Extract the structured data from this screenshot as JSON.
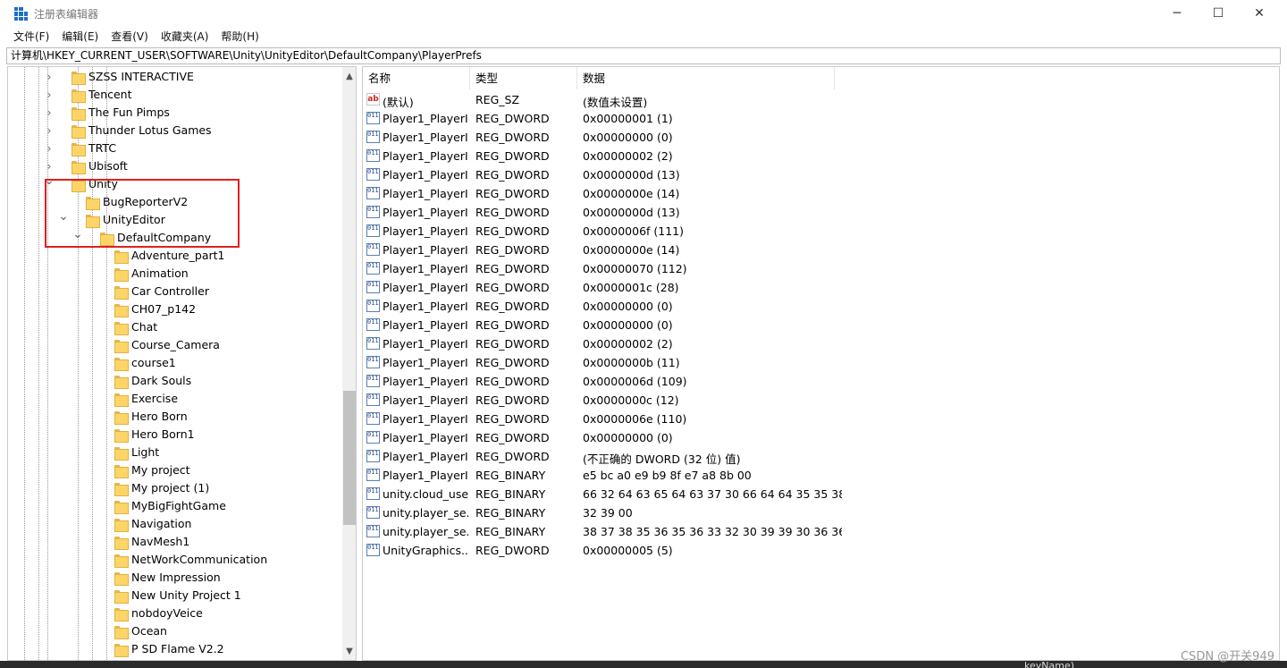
{
  "window": {
    "title": "注册表编辑器",
    "controls": {
      "minimize": "─",
      "maximize": "☐",
      "close": "✕"
    }
  },
  "menu": [
    "文件(F)",
    "编辑(E)",
    "查看(V)",
    "收藏夹(A)",
    "帮助(H)"
  ],
  "address": "计算机\\HKEY_CURRENT_USER\\SOFTWARE\\Unity\\UnityEditor\\DefaultCompany\\PlayerPrefs",
  "tree": {
    "items": [
      {
        "label": "SZSS INTERACTIVE",
        "level": 0,
        "expander": "collapsed"
      },
      {
        "label": "Tencent",
        "level": 0,
        "expander": "collapsed"
      },
      {
        "label": "The Fun Pimps",
        "level": 0,
        "expander": "collapsed"
      },
      {
        "label": "Thunder Lotus Games",
        "level": 0,
        "expander": "collapsed"
      },
      {
        "label": "TRTC",
        "level": 0,
        "expander": "collapsed"
      },
      {
        "label": "Ubisoft",
        "level": 0,
        "expander": "collapsed"
      },
      {
        "label": "Unity",
        "level": 0,
        "expander": "expanded"
      },
      {
        "label": "BugReporterV2",
        "level": 1,
        "expander": "none"
      },
      {
        "label": "UnityEditor",
        "level": 1,
        "expander": "expanded"
      },
      {
        "label": "DefaultCompany",
        "level": 2,
        "expander": "expanded"
      },
      {
        "label": "Adventure_part1",
        "level": 3,
        "expander": "none"
      },
      {
        "label": "Animation",
        "level": 3,
        "expander": "none"
      },
      {
        "label": "Car Controller",
        "level": 3,
        "expander": "none"
      },
      {
        "label": "CH07_p142",
        "level": 3,
        "expander": "none"
      },
      {
        "label": "Chat",
        "level": 3,
        "expander": "none"
      },
      {
        "label": "Course_Camera",
        "level": 3,
        "expander": "none"
      },
      {
        "label": "course1",
        "level": 3,
        "expander": "none"
      },
      {
        "label": "Dark Souls",
        "level": 3,
        "expander": "none"
      },
      {
        "label": "Exercise",
        "level": 3,
        "expander": "none"
      },
      {
        "label": "Hero Born",
        "level": 3,
        "expander": "none"
      },
      {
        "label": "Hero Born1",
        "level": 3,
        "expander": "none"
      },
      {
        "label": "Light",
        "level": 3,
        "expander": "none"
      },
      {
        "label": "My project",
        "level": 3,
        "expander": "none"
      },
      {
        "label": "My project (1)",
        "level": 3,
        "expander": "none"
      },
      {
        "label": "MyBigFightGame",
        "level": 3,
        "expander": "none"
      },
      {
        "label": "Navigation",
        "level": 3,
        "expander": "none"
      },
      {
        "label": "NavMesh1",
        "level": 3,
        "expander": "none"
      },
      {
        "label": "NetWorkCommunication",
        "level": 3,
        "expander": "none"
      },
      {
        "label": "New Impression",
        "level": 3,
        "expander": "none"
      },
      {
        "label": "New Unity Project 1",
        "level": 3,
        "expander": "none"
      },
      {
        "label": "nobdoyVeice",
        "level": 3,
        "expander": "none"
      },
      {
        "label": "Ocean",
        "level": 3,
        "expander": "none"
      },
      {
        "label": "P SD Flame V2.2",
        "level": 3,
        "expander": "none"
      }
    ]
  },
  "list": {
    "columns": [
      "名称",
      "类型",
      "数据"
    ],
    "rows": [
      {
        "icon": "ab",
        "name": "(默认)",
        "type": "REG_SZ",
        "data": "(数值未设置)"
      },
      {
        "icon": "bin",
        "name": "Player1_PlayerI...",
        "type": "REG_DWORD",
        "data": "0x00000001 (1)"
      },
      {
        "icon": "bin",
        "name": "Player1_PlayerI...",
        "type": "REG_DWORD",
        "data": "0x00000000 (0)"
      },
      {
        "icon": "bin",
        "name": "Player1_PlayerI...",
        "type": "REG_DWORD",
        "data": "0x00000002 (2)"
      },
      {
        "icon": "bin",
        "name": "Player1_PlayerI...",
        "type": "REG_DWORD",
        "data": "0x0000000d (13)"
      },
      {
        "icon": "bin",
        "name": "Player1_PlayerI...",
        "type": "REG_DWORD",
        "data": "0x0000000e (14)"
      },
      {
        "icon": "bin",
        "name": "Player1_PlayerI...",
        "type": "REG_DWORD",
        "data": "0x0000000d (13)"
      },
      {
        "icon": "bin",
        "name": "Player1_PlayerI...",
        "type": "REG_DWORD",
        "data": "0x0000006f (111)"
      },
      {
        "icon": "bin",
        "name": "Player1_PlayerI...",
        "type": "REG_DWORD",
        "data": "0x0000000e (14)"
      },
      {
        "icon": "bin",
        "name": "Player1_PlayerI...",
        "type": "REG_DWORD",
        "data": "0x00000070 (112)"
      },
      {
        "icon": "bin",
        "name": "Player1_PlayerI...",
        "type": "REG_DWORD",
        "data": "0x0000001c (28)"
      },
      {
        "icon": "bin",
        "name": "Player1_PlayerI...",
        "type": "REG_DWORD",
        "data": "0x00000000 (0)"
      },
      {
        "icon": "bin",
        "name": "Player1_PlayerI...",
        "type": "REG_DWORD",
        "data": "0x00000000 (0)"
      },
      {
        "icon": "bin",
        "name": "Player1_PlayerI...",
        "type": "REG_DWORD",
        "data": "0x00000002 (2)"
      },
      {
        "icon": "bin",
        "name": "Player1_PlayerI...",
        "type": "REG_DWORD",
        "data": "0x0000000b (11)"
      },
      {
        "icon": "bin",
        "name": "Player1_PlayerI...",
        "type": "REG_DWORD",
        "data": "0x0000006d (109)"
      },
      {
        "icon": "bin",
        "name": "Player1_PlayerI...",
        "type": "REG_DWORD",
        "data": "0x0000000c (12)"
      },
      {
        "icon": "bin",
        "name": "Player1_PlayerI...",
        "type": "REG_DWORD",
        "data": "0x0000006e (110)"
      },
      {
        "icon": "bin",
        "name": "Player1_PlayerI...",
        "type": "REG_DWORD",
        "data": "0x00000000 (0)"
      },
      {
        "icon": "bin",
        "name": "Player1_PlayerI...",
        "type": "REG_DWORD",
        "data": "(不正确的 DWORD  (32 位) 值)"
      },
      {
        "icon": "bin",
        "name": "Player1_PlayerI...",
        "type": "REG_BINARY",
        "data": "e5 bc a0 e9 b9 8f e7 a8 8b 00"
      },
      {
        "icon": "bin",
        "name": "unity.cloud_use...",
        "type": "REG_BINARY",
        "data": "66 32 64 63 65 64 63 37 30 66 64 64 35 35 38..."
      },
      {
        "icon": "bin",
        "name": "unity.player_se...",
        "type": "REG_BINARY",
        "data": "32 39 00"
      },
      {
        "icon": "bin",
        "name": "unity.player_se...",
        "type": "REG_BINARY",
        "data": "38 37 38 35 36 35 36 33 32 30 39 39 30 36 36..."
      },
      {
        "icon": "bin",
        "name": "UnityGraphics...",
        "type": "REG_DWORD",
        "data": "0x00000005 (5)"
      }
    ]
  },
  "footer": {
    "watermark": "CSDN @开关949",
    "background_text": "keyName)"
  }
}
